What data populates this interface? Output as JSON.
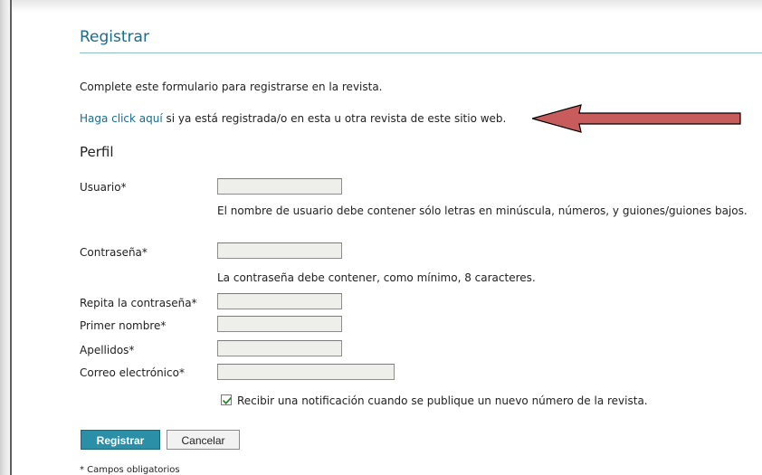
{
  "page": {
    "title": "Registrar",
    "intro_text": "Complete este formulario para registrarse en la revista.",
    "login_prompt": {
      "link_text": "Haga click aquí",
      "rest_text": " si ya está registrada/o en esta u otra revista de este sitio web."
    },
    "section_title": "Perfil",
    "required_note": "* Campos obligatorios"
  },
  "form": {
    "username": {
      "label": "Usuario*",
      "value": "",
      "hint": "El nombre de usuario debe contener sólo letras en minúscula, números, y guiones/guiones bajos."
    },
    "password": {
      "label": "Contraseña*",
      "value": "",
      "hint": "La contraseña debe contener, como mínimo, 8 caracteres."
    },
    "repeat_password": {
      "label": "Repita la contraseña*",
      "value": ""
    },
    "first_name": {
      "label": "Primer nombre*",
      "value": ""
    },
    "last_name": {
      "label": "Apellidos*",
      "value": ""
    },
    "email": {
      "label": "Correo electrónico*",
      "value": ""
    },
    "notification": {
      "checked": true,
      "label": "Recibir una notificación cuando se publique un nuevo número de la revista."
    },
    "buttons": {
      "register": "Registrar",
      "cancel": "Cancelar"
    }
  },
  "style": {
    "accent_color": "#1b6b8b",
    "primary_button_color": "#2a8fa7",
    "arrow_color": "#c85c5c",
    "field_background": "#eeeeea",
    "checkbox_icon": "check-icon",
    "arrow_icon": "left-arrow-icon"
  }
}
